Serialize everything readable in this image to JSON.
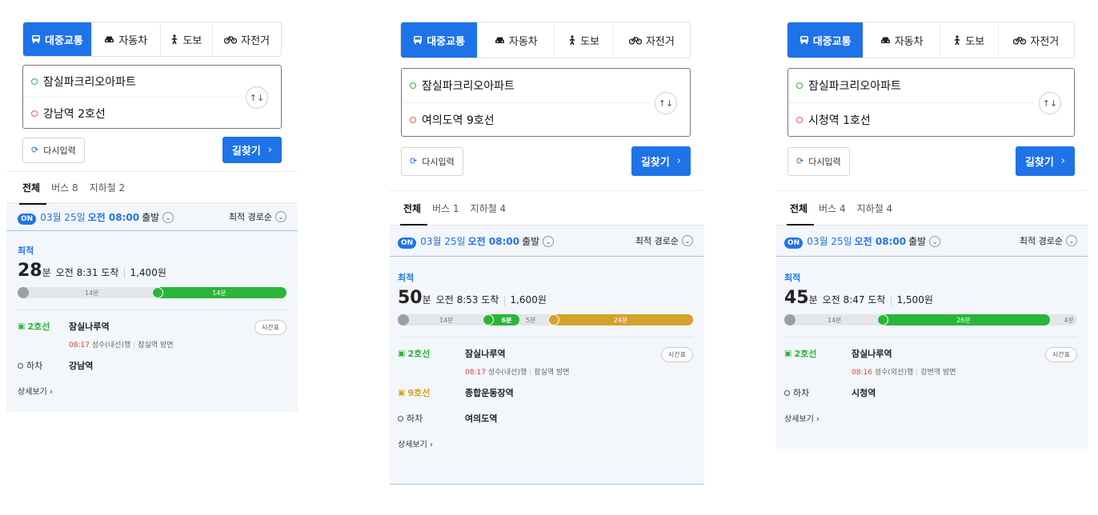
{
  "tabs": {
    "transit": "대중교통",
    "car": "자동차",
    "walk": "도보",
    "bike": "자전거"
  },
  "reset_label": "다시입력",
  "search_label": "길찾기",
  "search_chevron": "›",
  "swap_icon": "↑↓",
  "categories": {
    "all": "전체"
  },
  "departure": {
    "on_badge": "ON",
    "date": "03월 25일",
    "time": "오전 08:00",
    "suffix": "출발"
  },
  "sort_label": "최적 경로순",
  "best_label": "최적",
  "timetable_label": "시간표",
  "detail_label": "상세보기 ›",
  "colors": {
    "accent": "#1f73e8",
    "line2": "#2ab53a",
    "line9": "#d4a22b",
    "arrival_time": "#e0463e"
  },
  "panels": [
    {
      "origin": "잠실파크리오아파트",
      "destination": "강남역 2호선",
      "bus_tab": "버스 8",
      "subway_tab": "지하철 2",
      "minutes": "28",
      "minute_unit": "분",
      "arrival": "오전 8:31 도착",
      "fare": "1,400원",
      "progress": {
        "walk_label": "14분",
        "ride_label": "14분",
        "walk_fraction": 0.5,
        "ride_fraction": 0.5
      },
      "steps": {
        "line": "2호선",
        "station": "잠실나루역",
        "time": "08:17",
        "direction": "성수(내선)행",
        "platform": "잠실역 방면",
        "alight_label": "하차",
        "alight_station": "강남역"
      }
    },
    {
      "origin": "잠실파크리오아파트",
      "destination": "여의도역 9호선",
      "bus_tab": "버스 1",
      "subway_tab": "지하철 4",
      "minutes": "50",
      "minute_unit": "분",
      "arrival": "오전 8:53 도착",
      "fare": "1,600원",
      "progress": {
        "walk_label": "14분",
        "ride1_label": "6분",
        "walk2_label": "5분",
        "ride2_label": "24분",
        "walk_fraction": 0.28,
        "ride1_fraction": 0.12,
        "walk2_fraction": 0.1,
        "ride2_fraction": 0.5
      },
      "steps": {
        "line": "2호선",
        "station": "잠실나루역",
        "time": "08:17",
        "direction": "성수(내선)행",
        "platform": "잠실역 방면",
        "transfer_line": "9호선",
        "transfer_station": "종합운동장역",
        "alight_label": "하차",
        "alight_station": "여의도역"
      }
    },
    {
      "origin": "잠실파크리오아파트",
      "destination": "시청역 1호선",
      "bus_tab": "버스 4",
      "subway_tab": "지하철 4",
      "minutes": "45",
      "minute_unit": "분",
      "arrival": "오전 8:47 도착",
      "fare": "1,500원",
      "progress": {
        "walk_label": "14분",
        "ride_label": "26분",
        "walk2_label": "4분",
        "walk_fraction": 0.32,
        "ride_fraction": 0.59,
        "walk2_fraction": 0.09
      },
      "steps": {
        "line": "2호선",
        "station": "잠실나루역",
        "time": "08:16",
        "direction": "성수(외선)행",
        "platform": "강변역 방면",
        "alight_label": "하차",
        "alight_station": "시청역"
      }
    }
  ]
}
